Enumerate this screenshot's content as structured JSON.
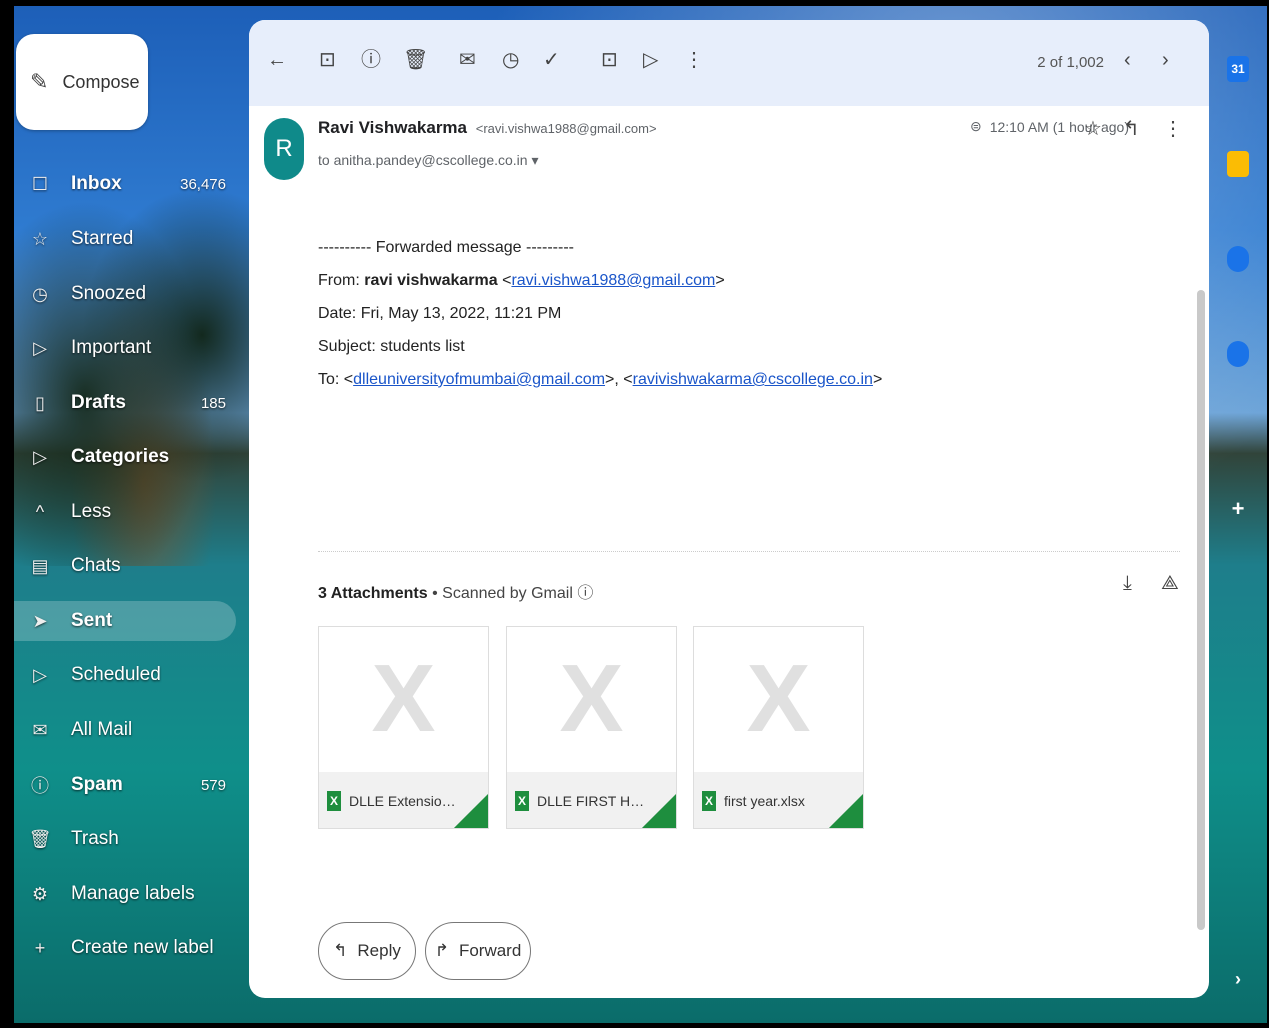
{
  "compose": {
    "label": "Compose",
    "icon": "pencil-icon"
  },
  "nav": [
    {
      "icon": "inbox-icon",
      "label": "Inbox",
      "count": "36,476",
      "bold": true
    },
    {
      "icon": "star-icon",
      "label": "Starred",
      "count": ""
    },
    {
      "icon": "clock-icon",
      "label": "Snoozed",
      "count": ""
    },
    {
      "icon": "important-icon",
      "label": "Important",
      "count": ""
    },
    {
      "icon": "draft-icon",
      "label": "Drafts",
      "count": "185",
      "bold": true
    },
    {
      "icon": "label-icon",
      "label": "Categories",
      "count": "",
      "bold": true
    },
    {
      "icon": "chevron-up-icon",
      "label": "Less",
      "count": ""
    },
    {
      "icon": "chat-icon",
      "label": "Chats",
      "count": ""
    },
    {
      "icon": "send-icon",
      "label": "Sent",
      "count": "",
      "active": true
    },
    {
      "icon": "scheduled-icon",
      "label": "Scheduled",
      "count": ""
    },
    {
      "icon": "all-mail-icon",
      "label": "All Mail",
      "count": ""
    },
    {
      "icon": "spam-icon",
      "label": "Spam",
      "count": "579",
      "bold": true
    },
    {
      "icon": "trash-icon",
      "label": "Trash",
      "count": ""
    },
    {
      "icon": "gear-icon",
      "label": "Manage labels",
      "count": ""
    },
    {
      "icon": "plus-icon",
      "label": "Create new label",
      "count": ""
    }
  ],
  "toolbar": {
    "pager": "2 of 1,002"
  },
  "email": {
    "avatar_letter": "R",
    "sender_name": "Ravi Vishwakarma",
    "sender_email": "<ravi.vishwa1988@gmail.com>",
    "to": "to anitha.pandey@cscollege.co.in",
    "time": "12:10 AM (1 hour ago)",
    "forwarded_header": "---------- Forwarded message ---------",
    "from_label": "From: ",
    "from_name": "ravi vishwakarma",
    "from_email": "ravi.vishwa1988@gmail.com",
    "date_line": "Date: Fri, May 13, 2022, 11:21 PM",
    "subject_line": "Subject: students list",
    "to_label": "To: ",
    "to_email1": "dlleuniversityofmumbai@gmail.com",
    "to_email2": "ravivishwakarma@cscollege.co.in"
  },
  "attachments": {
    "count_label": "3 Attachments",
    "scanned_label": "Scanned by Gmail",
    "files": [
      {
        "name": "DLLE Extension p..."
      },
      {
        "name": "DLLE FIRST HALF..."
      },
      {
        "name": "first year.xlsx"
      }
    ]
  },
  "actions": {
    "reply": "Reply",
    "forward": "Forward"
  },
  "rightbar": [
    {
      "icon": "calendar-icon",
      "text": "31",
      "color": "#1a73e8"
    },
    {
      "icon": "keep-icon",
      "text": "",
      "color": "#fbbc04"
    },
    {
      "icon": "tasks-icon",
      "text": "",
      "color": "#1a73e8"
    },
    {
      "icon": "contacts-icon",
      "text": "",
      "color": "#1a73e8"
    }
  ]
}
